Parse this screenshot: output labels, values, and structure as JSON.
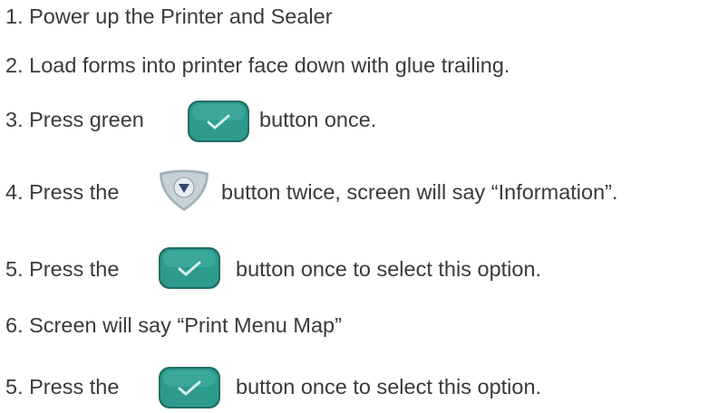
{
  "steps": [
    {
      "text": "1. Power up the Printer and Sealer"
    },
    {
      "text": "2. Load forms into printer face down with glue trailing."
    },
    {
      "pre": "3. Press green",
      "post": "button once.",
      "icon": "check-button-icon"
    },
    {
      "pre": "4. Press the",
      "post": "button twice, screen will say “Information”.",
      "icon": "down-arrow-button-icon"
    },
    {
      "pre": "5. Press the",
      "post": "button once to select this option.",
      "icon": "check-button-icon"
    },
    {
      "text": "6. Screen will say “Print Menu Map”"
    },
    {
      "pre": "5. Press the",
      "post": "button once to select this option.",
      "icon": "check-button-icon"
    }
  ],
  "colors": {
    "text": "#3a3a3a",
    "check_button": "#2e9a8c",
    "arrow_button": "#b8c4cc"
  }
}
